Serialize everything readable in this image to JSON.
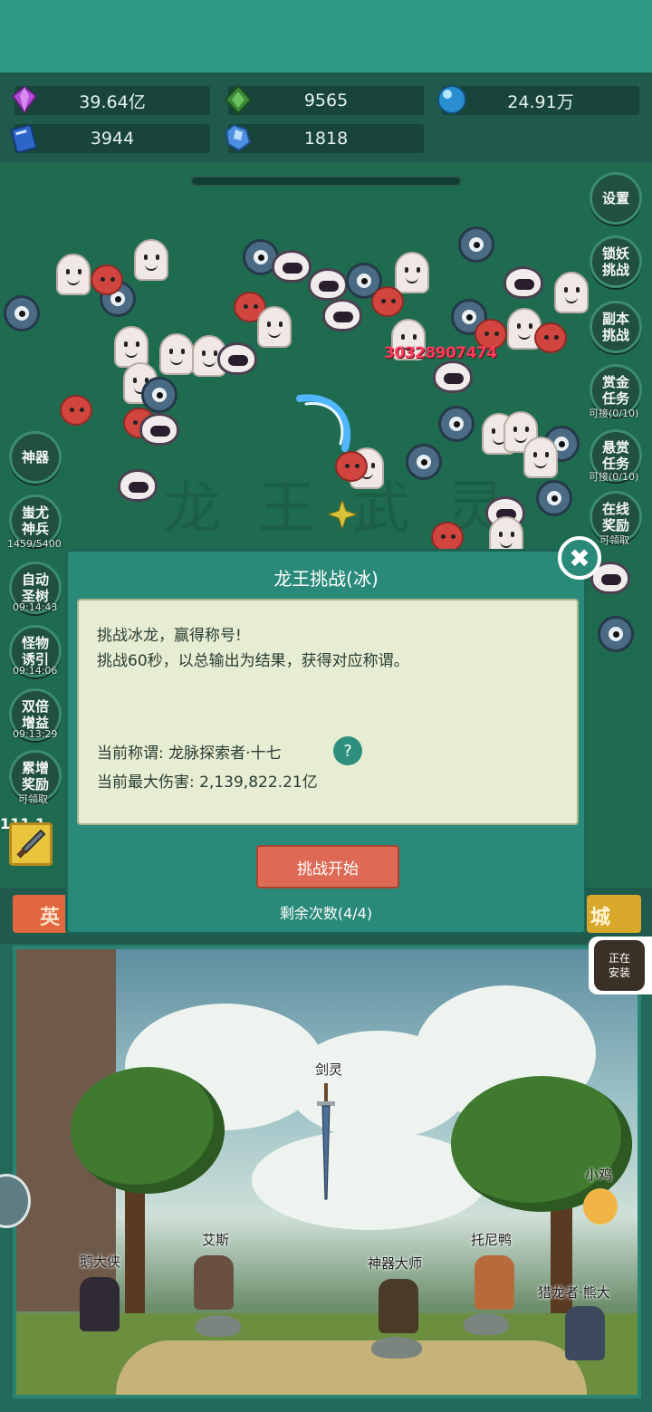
{
  "resources": [
    {
      "icon": "purple-gem-icon",
      "value": "39.64亿"
    },
    {
      "icon": "green-gem-icon",
      "value": "9565"
    },
    {
      "icon": "blue-orb-icon",
      "value": "24.91万"
    },
    {
      "icon": "blue-book-icon",
      "value": "3944"
    },
    {
      "icon": "ice-crystal-icon",
      "value": "1818"
    }
  ],
  "battle": {
    "damage_number": "30328907474"
  },
  "right_menu": [
    {
      "label": "设置",
      "sub": ""
    },
    {
      "label": "锁妖\n挑战",
      "sub": ""
    },
    {
      "label": "副本\n挑战",
      "sub": ""
    },
    {
      "label": "赏金\n任务",
      "sub": "可接(0/10)"
    },
    {
      "label": "悬赏\n任务",
      "sub": "可接(0/10)"
    },
    {
      "label": "在线\n奖励",
      "sub": "可领取"
    }
  ],
  "left_menu": [
    {
      "label": "神器",
      "sub": ""
    },
    {
      "label": "蚩尤\n神兵",
      "sub": "1459/5400"
    },
    {
      "label": "自动\n圣树",
      "sub": "09:14:43"
    },
    {
      "label": "怪物\n诱引",
      "sub": "09:14:06"
    },
    {
      "label": "双倍\n增益",
      "sub": "09:13:29"
    },
    {
      "label": "累增\n奖励",
      "sub": "可领取"
    }
  ],
  "bottom_tabs": {
    "left": "英",
    "right": "城"
  },
  "slot_text": "111 1",
  "install_badge": "正在\n安装",
  "dialog": {
    "title": "龙王挑战(冰)",
    "line1": "挑战冰龙，赢得称号!",
    "line2": "挑战60秒，以总输出为结果，获得对应称谓。",
    "current_title_label": "当前称谓: ",
    "current_title_value": "龙脉探索者·十七",
    "max_damage_label": "当前最大伤害: ",
    "max_damage_value": "2,139,822.21亿",
    "help": "?",
    "start_button": "挑战开始",
    "remaining": "剩余次数(4/4)",
    "close": "✖"
  },
  "scene_npcs": [
    {
      "name": "剑灵"
    },
    {
      "name": "小鸡"
    },
    {
      "name": "艾斯"
    },
    {
      "name": "鹅大侠"
    },
    {
      "name": "托尼鸭"
    },
    {
      "name": "神器大师"
    },
    {
      "name": "猎龙者·熊大"
    }
  ],
  "colors": {
    "header": "#2d9a84",
    "dialog": "#2a8a7a",
    "dialog_body": "#e6edd2",
    "start_button": "#de6a55"
  }
}
